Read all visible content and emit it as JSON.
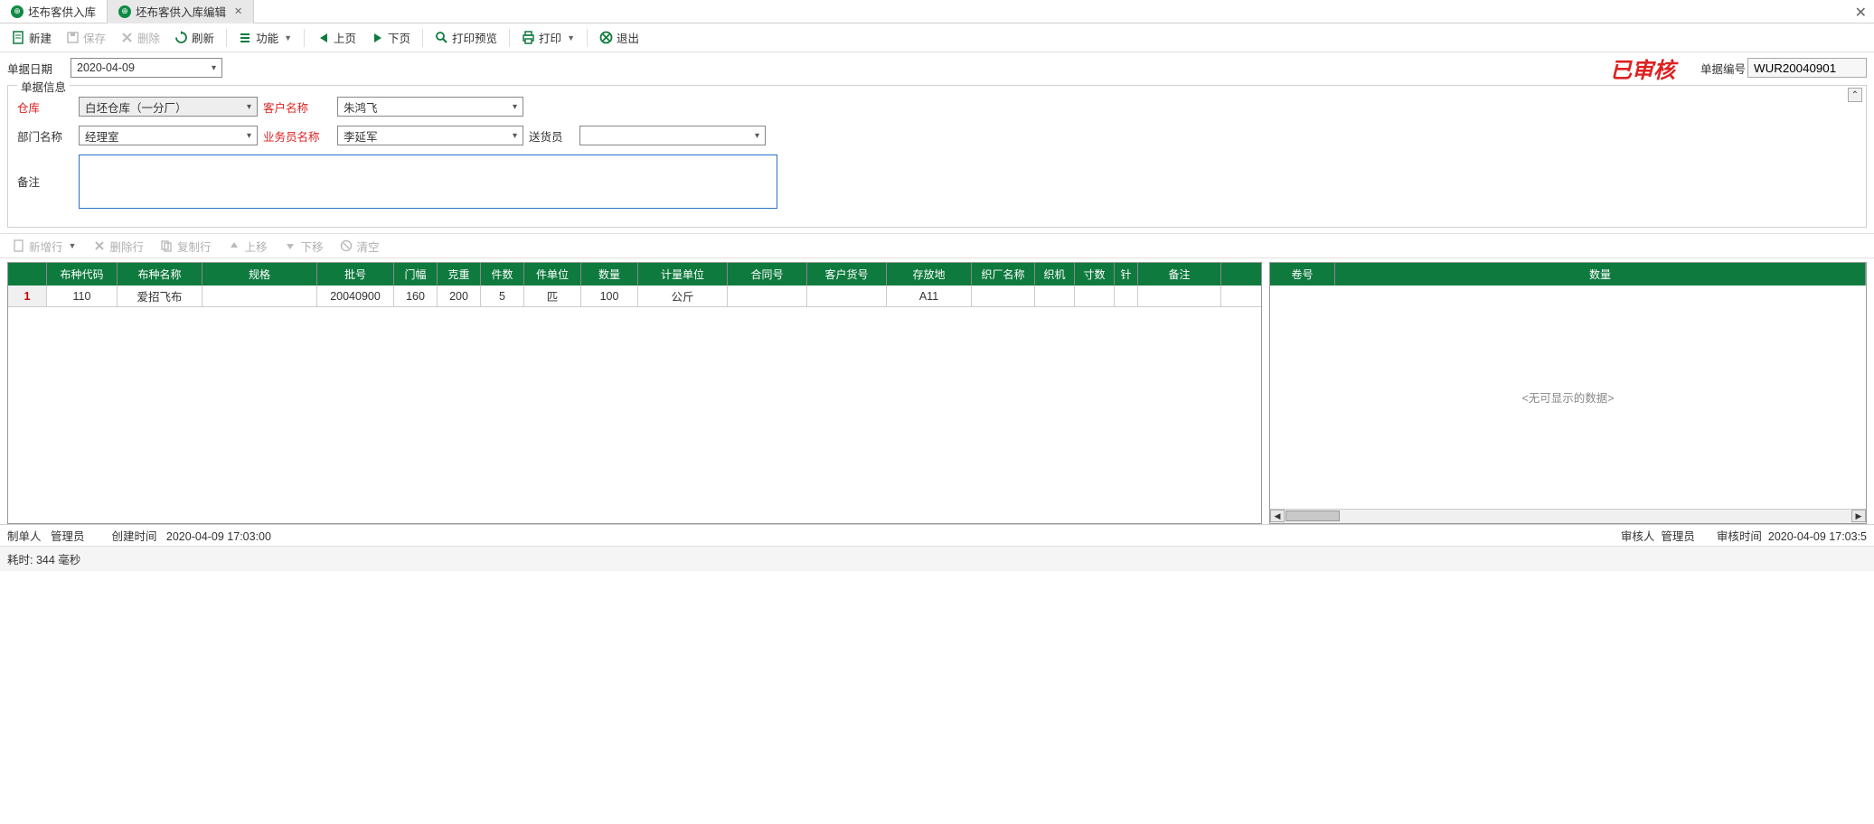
{
  "tabs": [
    {
      "label": "坯布客供入库",
      "active": false,
      "closable": false
    },
    {
      "label": "坯布客供入库编辑",
      "active": true,
      "closable": true
    }
  ],
  "toolbar": {
    "new_": "新建",
    "save": "保存",
    "delete_": "删除",
    "refresh": "刷新",
    "functions": "功能",
    "prev": "上页",
    "next": "下页",
    "print_preview": "打印预览",
    "print": "打印",
    "exit": "退出"
  },
  "header": {
    "date_label": "单据日期",
    "date_value": "2020-04-09",
    "stamp": "已审核",
    "doc_no_label": "单据编号",
    "doc_no_value": "WUR20040901"
  },
  "fieldset": {
    "title": "单据信息",
    "warehouse_label": "仓库",
    "warehouse_value": "白坯仓库（一分厂）",
    "customer_label": "客户名称",
    "customer_value": "朱鸿飞",
    "dept_label": "部门名称",
    "dept_value": "经理室",
    "salesman_label": "业务员名称",
    "salesman_value": "李延军",
    "deliverer_label": "送货员",
    "deliverer_value": "",
    "remark_label": "备注",
    "remark_value": ""
  },
  "grid_toolbar": {
    "add_row": "新增行",
    "del_row": "删除行",
    "copy_row": "复制行",
    "move_up": "上移",
    "move_down": "下移",
    "clear": "清空"
  },
  "main_grid": {
    "columns": [
      "",
      "布种代码",
      "布种名称",
      "规格",
      "批号",
      "门幅",
      "克重",
      "件数",
      "件单位",
      "数量",
      "计量单位",
      "合同号",
      "客户货号",
      "存放地",
      "织厂名称",
      "织机",
      "寸数",
      "针",
      "备注"
    ],
    "rows": [
      {
        "n": "1",
        "cells": [
          "110",
          "爱招飞布",
          "",
          "20040900",
          "160",
          "200",
          "5",
          "匹",
          "100",
          "公斤",
          "",
          "",
          "A11",
          "",
          "",
          "",
          "",
          ""
        ]
      }
    ]
  },
  "side_grid": {
    "columns": [
      "卷号",
      "数量"
    ],
    "no_data": "<无可显示的数据>"
  },
  "status": {
    "creator_label": "制单人",
    "creator_value": "管理员",
    "create_time_label": "创建时间",
    "create_time_value": "2020-04-09 17:03:00",
    "auditor_label": "审核人",
    "auditor_value": "管理员",
    "audit_time_label": "审核时间",
    "audit_time_value": "2020-04-09 17:03:5"
  },
  "timing": "耗时: 344 毫秒"
}
